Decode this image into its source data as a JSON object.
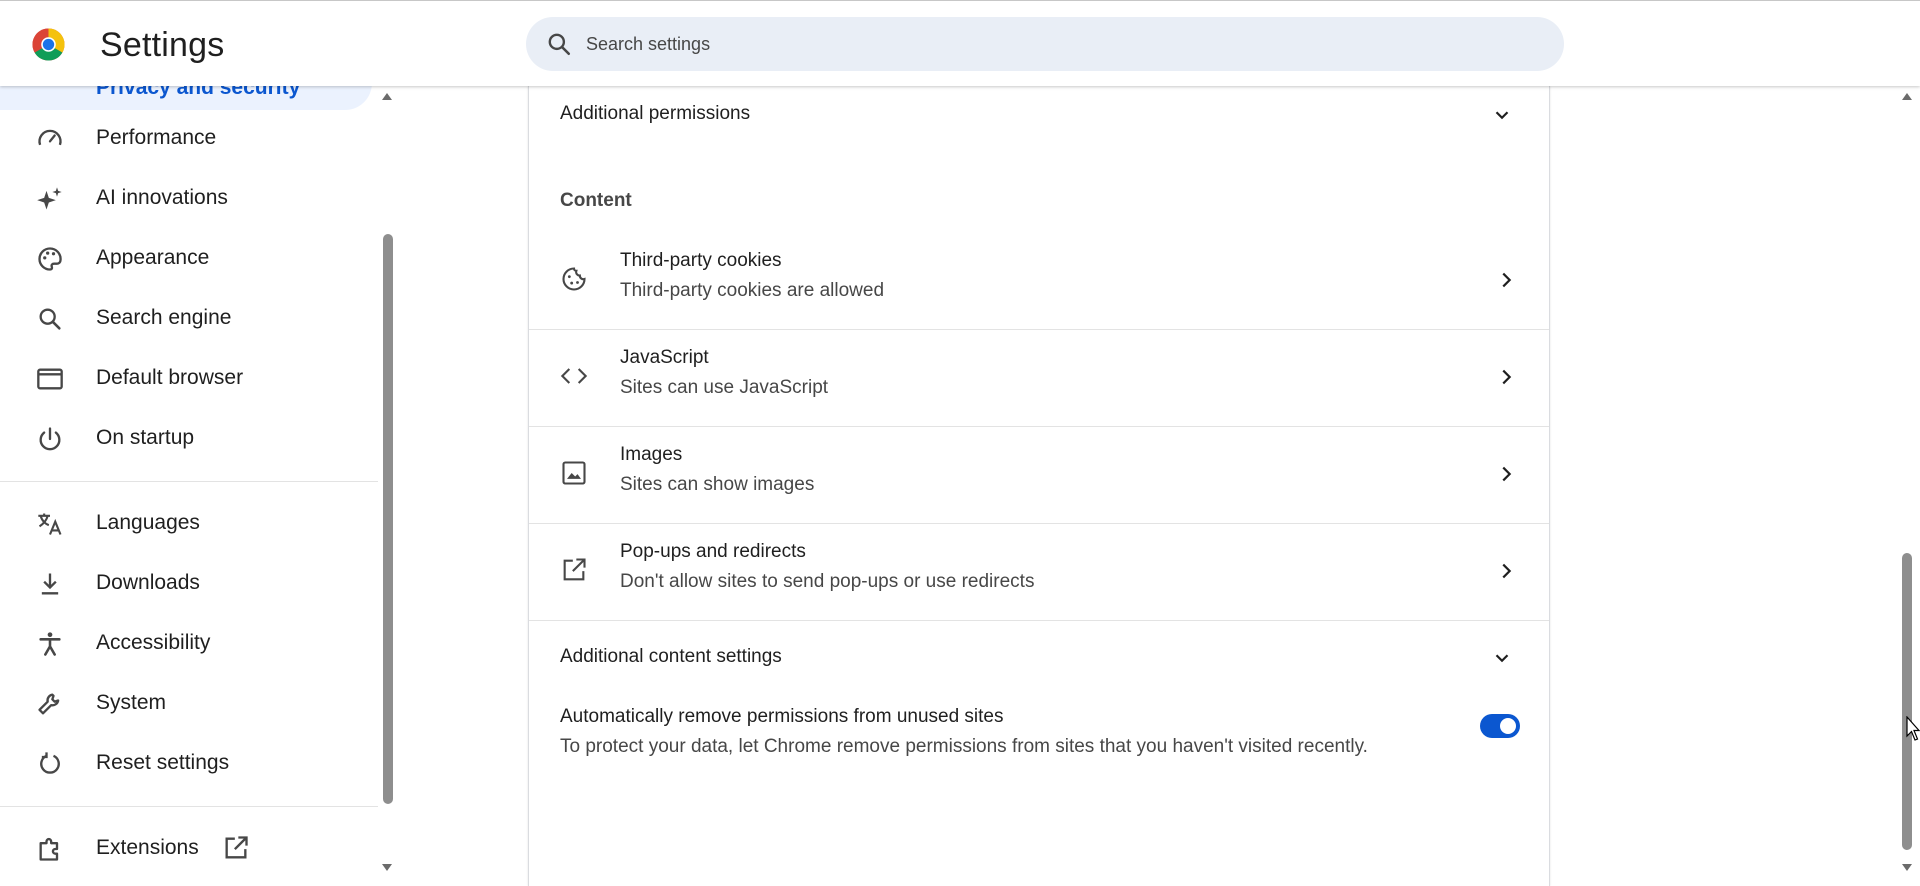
{
  "header": {
    "title": "Settings",
    "search_placeholder": "Search settings"
  },
  "sidebar": {
    "active_item": "Privacy and security",
    "items": [
      {
        "label": "Performance",
        "icon": "speedometer-icon"
      },
      {
        "label": "AI innovations",
        "icon": "sparkle-icon"
      },
      {
        "label": "Appearance",
        "icon": "palette-icon"
      },
      {
        "label": "Search engine",
        "icon": "search-icon"
      },
      {
        "label": "Default browser",
        "icon": "browser-window-icon"
      },
      {
        "label": "On startup",
        "icon": "power-icon"
      },
      {
        "label": "Languages",
        "icon": "translate-icon"
      },
      {
        "label": "Downloads",
        "icon": "download-icon"
      },
      {
        "label": "Accessibility",
        "icon": "accessibility-icon"
      },
      {
        "label": "System",
        "icon": "wrench-icon"
      },
      {
        "label": "Reset settings",
        "icon": "reset-icon"
      },
      {
        "label": "Extensions",
        "icon": "puzzle-icon"
      }
    ]
  },
  "main": {
    "additional_permissions": "Additional permissions",
    "content_section": "Content",
    "permissions": [
      {
        "title": "Third-party cookies",
        "subtitle": "Third-party cookies are allowed",
        "icon": "cookie-icon"
      },
      {
        "title": "JavaScript",
        "subtitle": "Sites can use JavaScript",
        "icon": "code-icon"
      },
      {
        "title": "Images",
        "subtitle": "Sites can show images",
        "icon": "image-icon"
      },
      {
        "title": "Pop-ups and redirects",
        "subtitle": "Don't allow sites to send pop-ups or use redirects",
        "icon": "open-in-new-icon"
      }
    ],
    "additional_content_settings": "Additional content settings",
    "auto_remove": {
      "title": "Automatically remove permissions from unused sites",
      "subtitle": "To protect your data, let Chrome remove permissions from sites that you haven't visited recently.",
      "enabled": true
    }
  },
  "colors": {
    "accent": "#0b57d0",
    "search_bg": "#e9eef6",
    "active_bg": "#d3e3fd"
  }
}
